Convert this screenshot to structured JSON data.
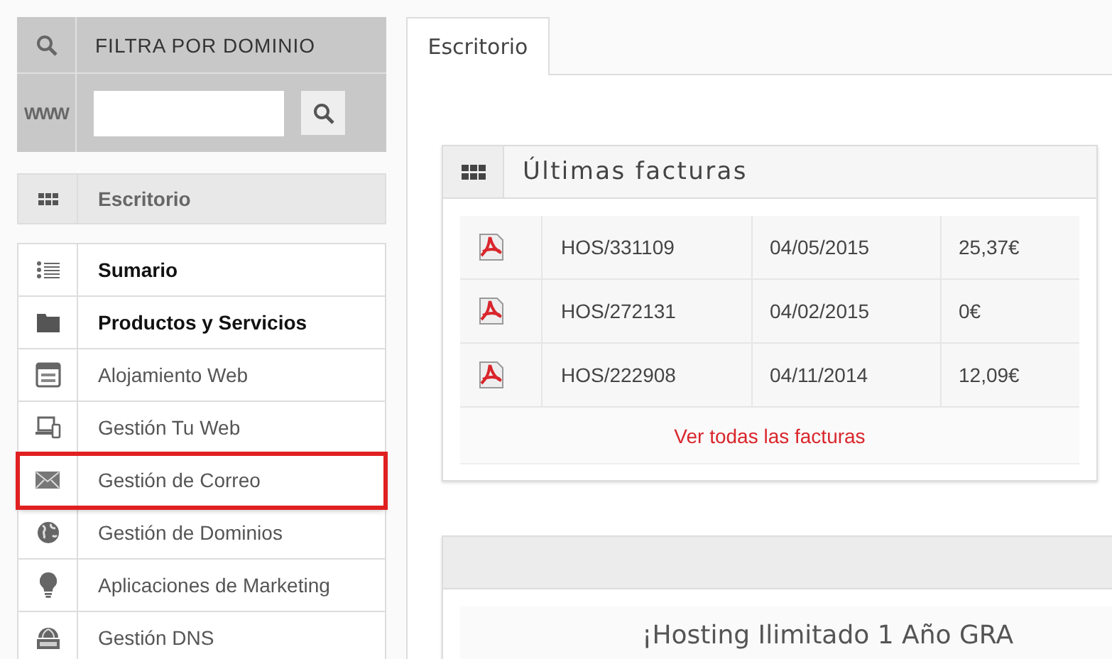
{
  "filter": {
    "title": "FILTRA POR DOMINIO",
    "prefix": "WWW"
  },
  "sidebar": {
    "home": {
      "label": "Escritorio",
      "selected": false
    },
    "items": [
      {
        "label": "Sumario",
        "kind": "section",
        "highlighted": false
      },
      {
        "label": "Productos y Servicios",
        "kind": "section",
        "highlighted": false
      },
      {
        "label": "Alojamiento Web",
        "kind": "link",
        "highlighted": false
      },
      {
        "label": "Gestión Tu Web",
        "kind": "link",
        "highlighted": false
      },
      {
        "label": "Gestión de Correo",
        "kind": "link",
        "highlighted": true
      },
      {
        "label": "Gestión de Dominios",
        "kind": "link",
        "highlighted": false
      },
      {
        "label": "Aplicaciones de Marketing",
        "kind": "link",
        "highlighted": false
      },
      {
        "label": "Gestión DNS",
        "kind": "link",
        "highlighted": false
      }
    ]
  },
  "tabs": [
    {
      "label": "Escritorio",
      "selected": true
    }
  ],
  "invoices": {
    "title": "Últimas facturas",
    "rows": [
      {
        "number": "HOS/331109",
        "date": "04/05/2015",
        "amount": "25,37€"
      },
      {
        "number": "HOS/272131",
        "date": "04/02/2015",
        "amount": "0€"
      },
      {
        "number": "HOS/222908",
        "date": "04/11/2014",
        "amount": "12,09€"
      }
    ],
    "footer_link": "Ver todas las facturas"
  },
  "promo": {
    "title": "¡Hosting Ilimitado 1 Año GRA"
  }
}
